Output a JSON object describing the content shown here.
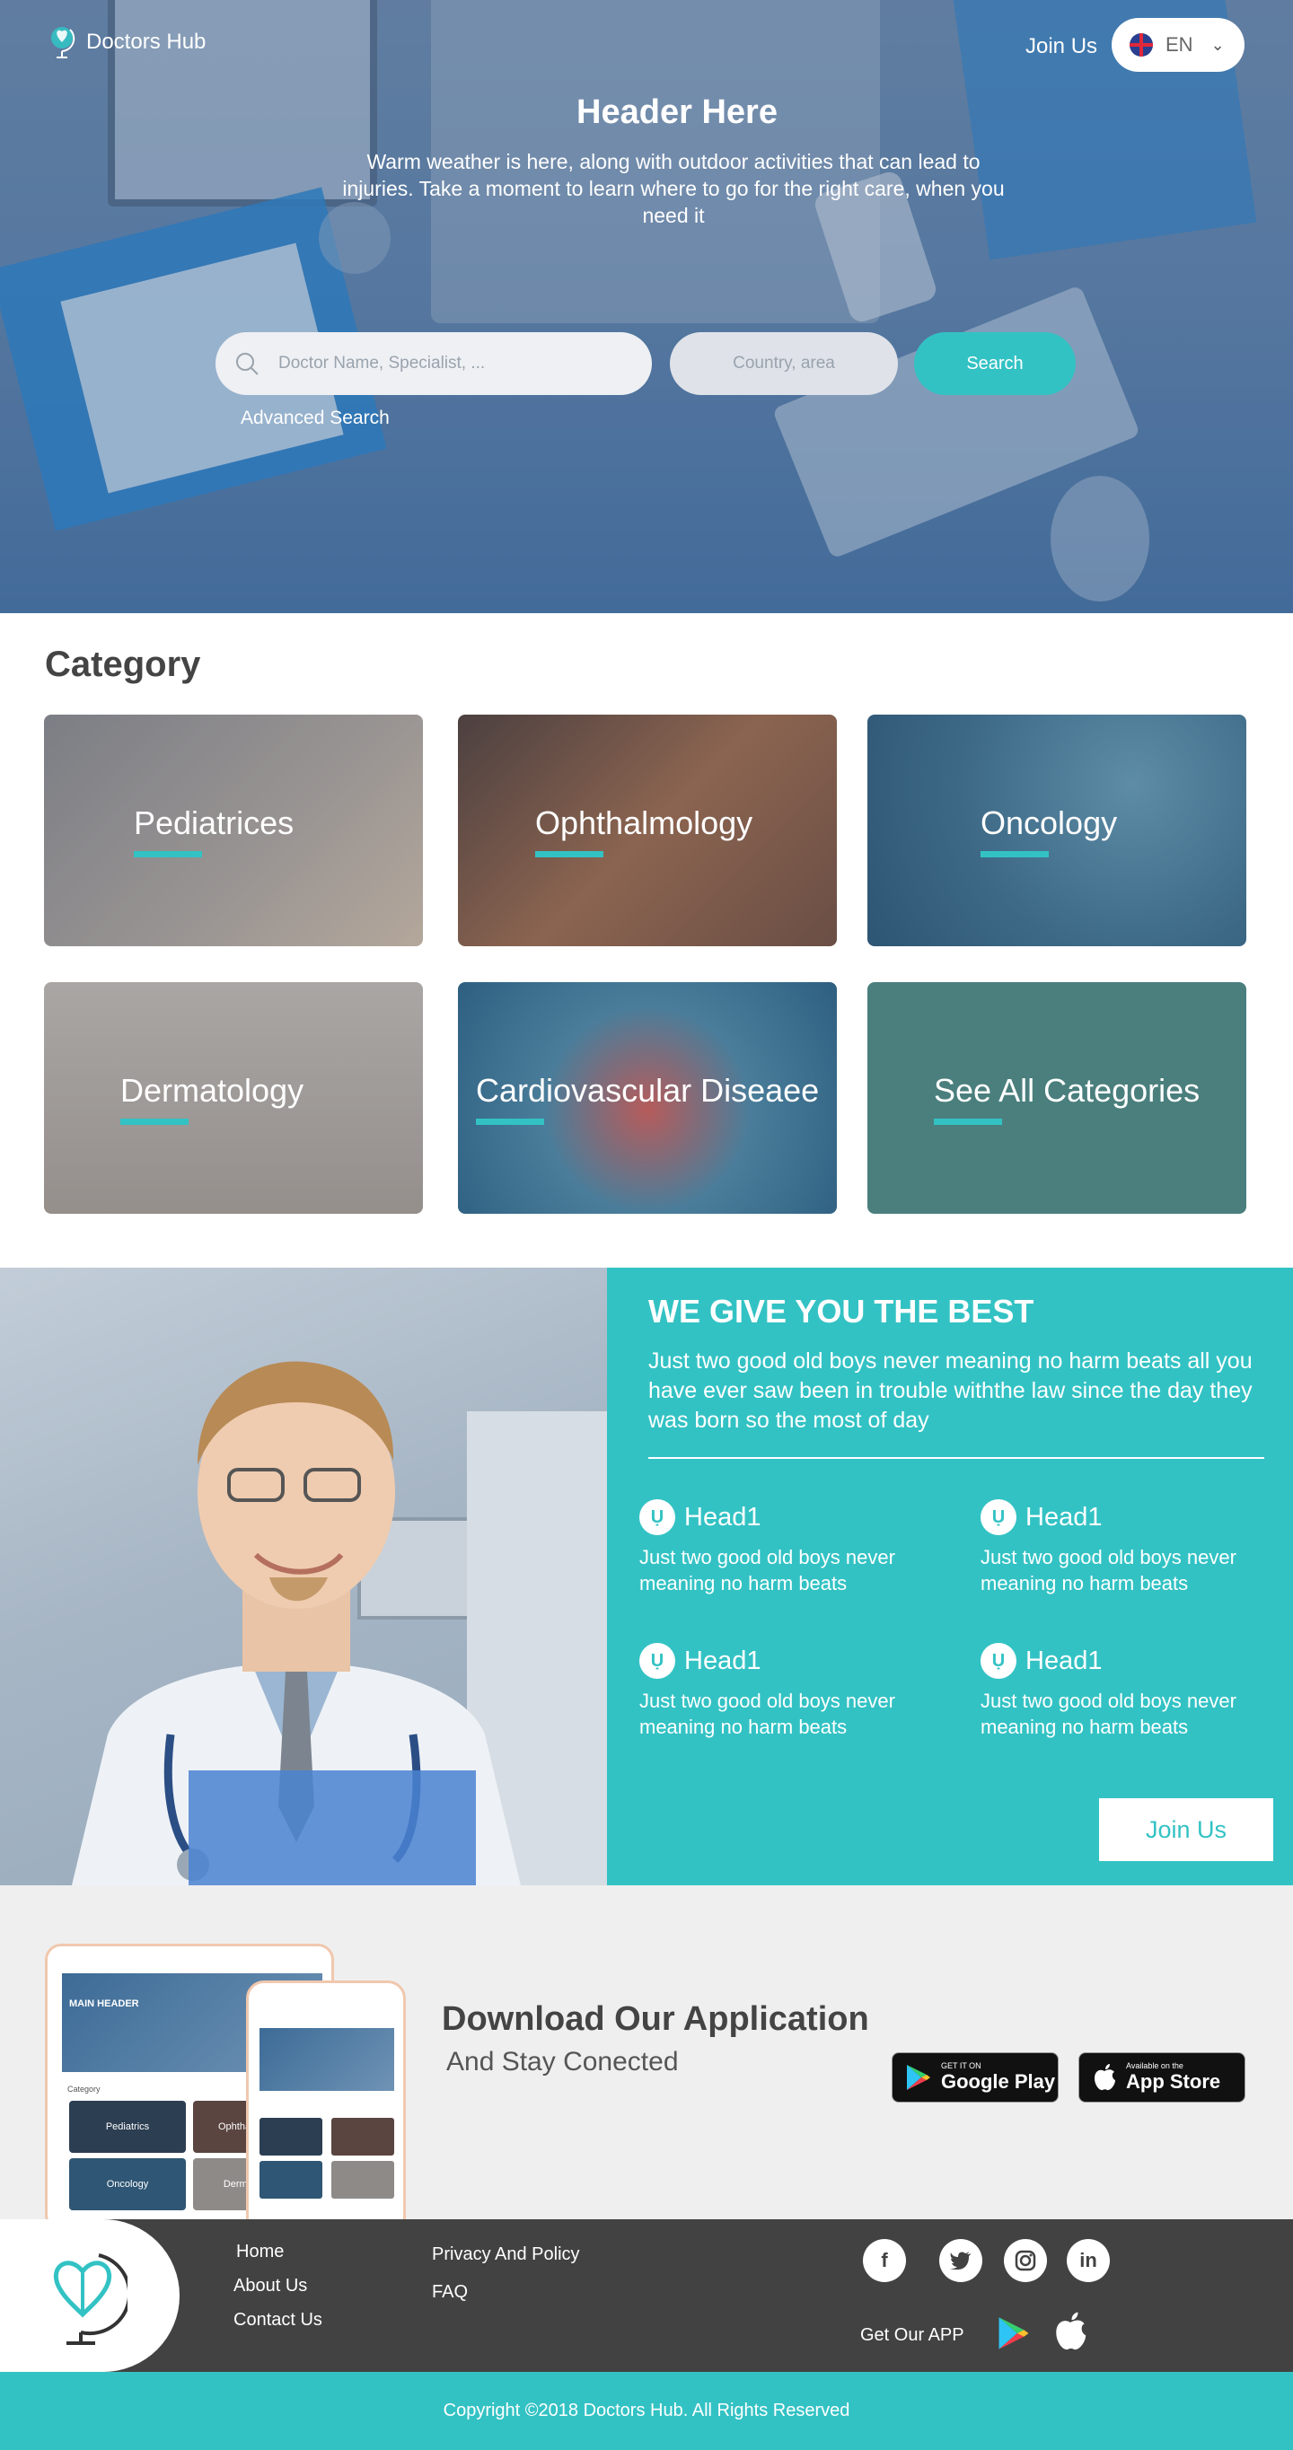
{
  "nav": {
    "brand": "Doctors Hub",
    "join": "Join Us",
    "language": "EN"
  },
  "hero": {
    "title": "Header Here",
    "subtitle": "Warm weather is here, along with outdoor activities that can lead to injuries. Take a moment to learn where to go for the right care, when you need it",
    "search_placeholder": "Doctor Name, Specialist, ...",
    "country_placeholder": "Country, area",
    "search_button": "Search",
    "advanced": "Advanced Search"
  },
  "category": {
    "title": "Category",
    "cards": [
      {
        "label": "Pediatrices"
      },
      {
        "label": "Ophthalmology"
      },
      {
        "label": "Oncology"
      },
      {
        "label": "Dermatology"
      },
      {
        "label": "Cardiovascular Diseaee"
      },
      {
        "label": "See All Categories"
      }
    ]
  },
  "best": {
    "title": "WE GIVE YOU THE BEST",
    "text": "Just two good old boys never meaning no harm beats all you have ever saw been in trouble withthe law since the day they was born so the most of day",
    "features": [
      {
        "head": "Head1",
        "text": "Just two good old boys never  meaning no harm beats"
      },
      {
        "head": "Head1",
        "text": "Just two good old boys never  meaning no harm beats"
      },
      {
        "head": "Head1",
        "text": "Just two good old boys never  meaning no harm beats"
      },
      {
        "head": "Head1",
        "text": "Just two good old boys never  meaning no harm beats"
      }
    ],
    "button": "Join Us"
  },
  "download": {
    "title": "Download Our Application",
    "subtitle": "And Stay Conected",
    "google_small": "GET IT ON",
    "google_big": "Google Play",
    "apple_small": "Available on the",
    "apple_big": "App Store",
    "mock": {
      "main_header": "MAIN HEADER",
      "category": "Category",
      "tiles": [
        "Pediatrics",
        "Ophthalmology",
        "Oncology",
        "Dermatology"
      ]
    }
  },
  "footer": {
    "links_col1": [
      "Home",
      "About Us",
      "Contact Us"
    ],
    "links_col2": [
      "Privacy And Policy",
      "FAQ"
    ],
    "get_app": "Get Our APP",
    "social": [
      "facebook-icon",
      "twitter-icon",
      "instagram-icon",
      "linkedin-icon"
    ],
    "copyright": "Copyright ©2018 Doctors Hub. All Rights Reserved"
  },
  "colors": {
    "accent": "#33c2c4",
    "footer": "#424242",
    "download_bg": "#efefef"
  }
}
